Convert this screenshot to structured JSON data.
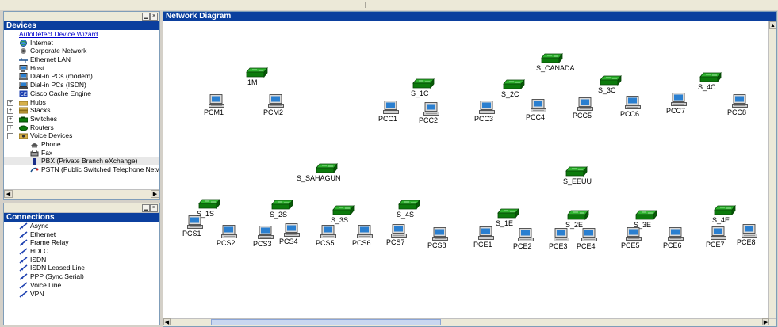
{
  "devices_panel": {
    "title": "Devices",
    "wizard": "AutoDetect Device Wizard",
    "items": [
      {
        "label": "Internet",
        "icon": "globe-icon",
        "expander": ""
      },
      {
        "label": "Corporate Network",
        "icon": "network-icon",
        "expander": ""
      },
      {
        "label": "Ethernet LAN",
        "icon": "ethernet-icon",
        "expander": ""
      },
      {
        "label": "Host",
        "icon": "host-icon",
        "expander": ""
      },
      {
        "label": "Dial-in PCs (modem)",
        "icon": "modem-pc-icon",
        "expander": ""
      },
      {
        "label": "Dial-in PCs (ISDN)",
        "icon": "isdn-pc-icon",
        "expander": ""
      },
      {
        "label": "Cisco Cache Engine",
        "icon": "cache-engine-icon",
        "expander": ""
      },
      {
        "label": "Hubs",
        "icon": "hub-icon",
        "expander": "+"
      },
      {
        "label": "Stacks",
        "icon": "stack-icon",
        "expander": "+"
      },
      {
        "label": "Switches",
        "icon": "switch-icon",
        "expander": "+"
      },
      {
        "label": "Routers",
        "icon": "router-icon",
        "expander": "+"
      },
      {
        "label": "Voice Devices",
        "icon": "voice-icon",
        "expander": "−"
      },
      {
        "label": "Phone",
        "icon": "phone-icon",
        "expander": ""
      },
      {
        "label": "Fax",
        "icon": "fax-icon",
        "expander": ""
      },
      {
        "label": "PBX (Private Branch eXchange)",
        "icon": "pbx-icon",
        "expander": ""
      },
      {
        "label": "PSTN (Public Switched Telephone Network)",
        "icon": "pstn-icon",
        "expander": ""
      }
    ]
  },
  "connections_panel": {
    "title": "Connections",
    "items": [
      "Async",
      "Ethernet",
      "Frame Relay",
      "HDLC",
      "ISDN",
      "ISDN Leased Line",
      "PPP (Sync Serial)",
      "Voice Line",
      "VPN"
    ]
  },
  "diagram": {
    "title": "Network Diagram",
    "colors": {
      "switch": "#0c7a0c",
      "pc": "#2a7fd0",
      "header": "#0b3f9e"
    },
    "switches": [
      "1M",
      "S_CANADA",
      "S_1C",
      "S_2C",
      "S_3C",
      "S_4C",
      "S_SAHAGUN",
      "S_EEUU",
      "S_1S",
      "S_2S",
      "S_3S",
      "S_4S",
      "S_1E",
      "S_2E",
      "S_3E",
      "S_4E"
    ],
    "pcs": [
      "PCM1",
      "PCM2",
      "PCC1",
      "PCC2",
      "PCC3",
      "PCC4",
      "PCC5",
      "PCC6",
      "PCC7",
      "PCC8",
      "PCS1",
      "PCS2",
      "PCS3",
      "PCS4",
      "PCS5",
      "PCS6",
      "PCS7",
      "PCS8",
      "PCE1",
      "PCE2",
      "PCE3",
      "PCE4",
      "PCE5",
      "PCE6",
      "PCE7",
      "PCE8"
    ]
  }
}
